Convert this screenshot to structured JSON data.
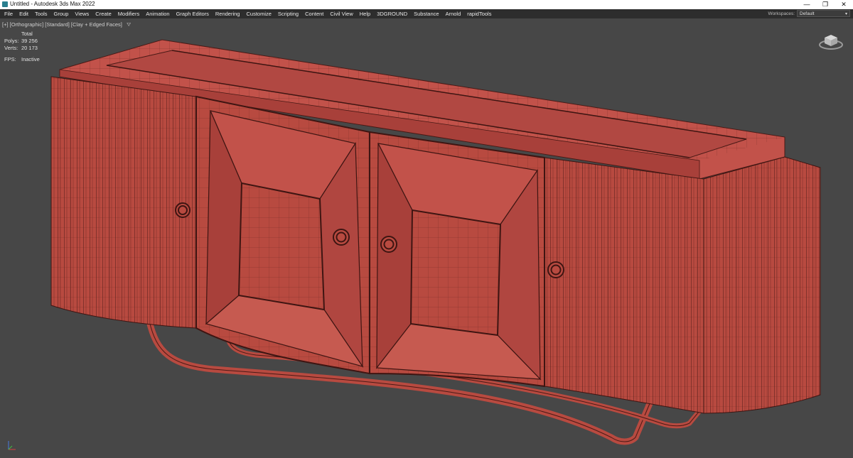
{
  "window": {
    "title": "Untitled - Autodesk 3ds Max 2022",
    "controls": [
      "—",
      "❐",
      "✕"
    ]
  },
  "menu": {
    "items": [
      "File",
      "Edit",
      "Tools",
      "Group",
      "Views",
      "Create",
      "Modifiers",
      "Animation",
      "Graph Editors",
      "Rendering",
      "Customize",
      "Scripting",
      "Content",
      "Civil View",
      "Help",
      "3DGROUND",
      "Substance",
      "Arnold",
      "rapidTools"
    ],
    "workspaces_label": "Workspaces:",
    "workspace_value": "Default"
  },
  "viewport": {
    "label": "[+] [Orthographic] [Standard] [Clay + Edged Faces]",
    "filter_icon": "funnel-icon",
    "stats": {
      "header": "Total",
      "polys_label": "Polys:",
      "polys_value": "39 256",
      "verts_label": "Verts:",
      "verts_value": "20 173",
      "fps_label": "FPS:",
      "fps_value": "Inactive"
    },
    "view_cube_icon": "viewcube-icon",
    "axis_icon": "axis-tripod-icon"
  },
  "colors": {
    "viewport_bg": "#474747",
    "model_face": "#b84a40",
    "model_shadow": "#9a3a32",
    "wire": "#4a1a16",
    "menubar_bg": "#2d2d2d"
  }
}
